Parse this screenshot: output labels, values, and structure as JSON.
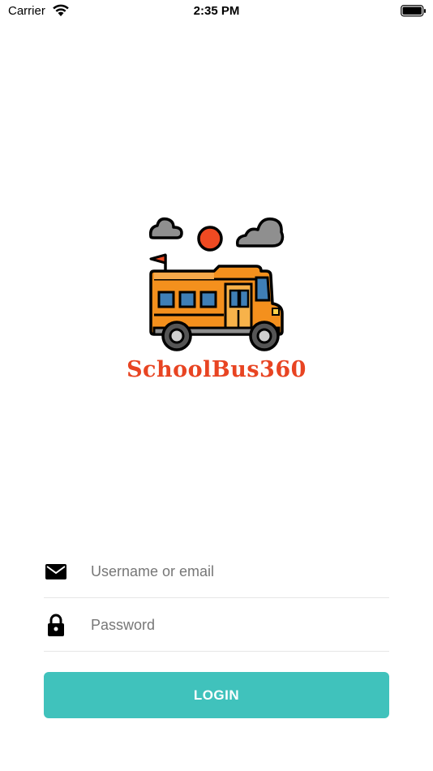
{
  "status_bar": {
    "carrier": "Carrier",
    "time": "2:35 PM",
    "wifi_icon": "wifi-icon",
    "battery_icon": "battery-icon"
  },
  "logo": {
    "app_name": "SchoolBus360",
    "image": "school-bus-logo",
    "brand_color": "#e84422"
  },
  "form": {
    "username": {
      "icon": "mail-icon",
      "placeholder": "Username or email",
      "value": ""
    },
    "password": {
      "icon": "lock-icon",
      "placeholder": "Password",
      "value": ""
    },
    "login_label": "LOGIN",
    "login_color": "#40c2bc"
  }
}
